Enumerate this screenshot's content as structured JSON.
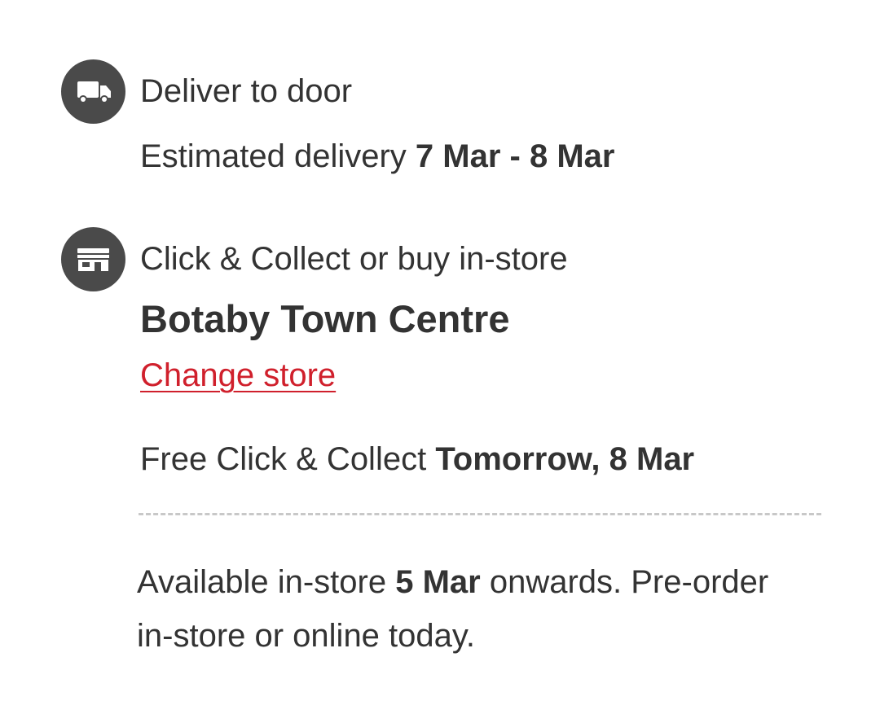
{
  "delivery": {
    "icon": "truck-icon",
    "title": "Deliver to door",
    "estimate_prefix": "Estimated delivery ",
    "estimate_dates": "7 Mar - 8 Mar"
  },
  "collect": {
    "icon": "store-icon",
    "title": "Click & Collect or buy in-store",
    "store_name": "Botaby Town Centre",
    "change_store_label": "Change store",
    "free_prefix": "Free Click & Collect ",
    "free_date": "Tomorrow, 8 Mar"
  },
  "availability": {
    "prefix": "Available in-store ",
    "date": "5 Mar",
    "suffix": " onwards. Pre-order in-store or online today."
  },
  "colors": {
    "text": "#333333",
    "icon_background": "#4a4a4a",
    "link": "#d0202c",
    "divider": "#c8c8c8"
  }
}
